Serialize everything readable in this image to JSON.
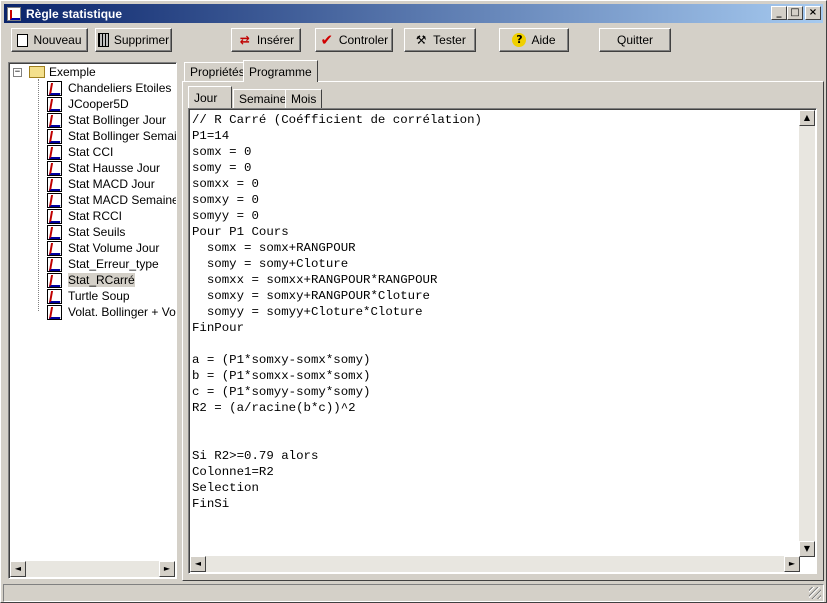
{
  "window": {
    "title": "Règle statistique",
    "minimize": "_",
    "maximize": "□",
    "close": "×"
  },
  "toolbar": {
    "nouveau": "Nouveau",
    "supprimer": "Supprimer",
    "inserer": "Insérer",
    "controler": "Controler",
    "tester": "Tester",
    "aide": "Aide",
    "quitter": "Quitter"
  },
  "tree": {
    "root": "Exemple",
    "expander": "−",
    "items": [
      "Chandeliers Etoiles",
      "JCooper5D",
      "Stat Bollinger Jour",
      "Stat Bollinger Semaine",
      "Stat CCI",
      "Stat Hausse Jour",
      "Stat MACD Jour",
      "Stat MACD Semaine",
      "Stat RCCI",
      "Stat Seuils",
      "Stat Volume Jour",
      "Stat_Erreur_type",
      "Stat_RCarré",
      "Turtle Soup",
      "Volat. Bollinger + Volur"
    ],
    "selected": "Stat_RCarré"
  },
  "tabs": {
    "proprietes": "Propriétés",
    "programme": "Programme"
  },
  "subtabs": {
    "jour": "Jour",
    "semaine": "Semaine",
    "mois": "Mois"
  },
  "code": "// R Carré (Coéfficient de corrélation)\nP1=14\nsomx = 0\nsomy = 0\nsomxx = 0\nsomxy = 0\nsomyy = 0\nPour P1 Cours\n  somx = somx+RANGPOUR\n  somy = somy+Cloture\n  somxx = somxx+RANGPOUR*RANGPOUR\n  somxy = somxy+RANGPOUR*Cloture\n  somyy = somyy+Cloture*Cloture\nFinPour\n\na = (P1*somxy-somx*somy)\nb = (P1*somxx-somx*somx)\nc = (P1*somyy-somy*somy)\nR2 = (a/racine(b*c))^2\n\n\nSi R2>=0.79 alors\nColonne1=R2\nSelection\nFinSi",
  "scroll": {
    "up": "▲",
    "down": "▼",
    "left": "◄",
    "right": "►"
  }
}
